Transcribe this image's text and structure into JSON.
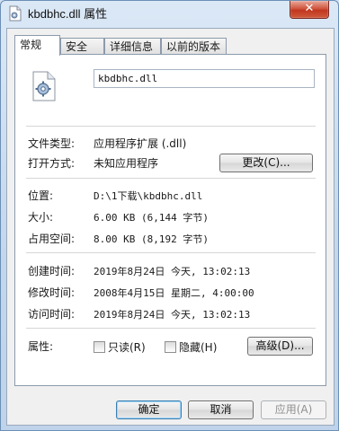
{
  "window": {
    "title": "kbdbhc.dll 属性",
    "close_glyph": "✕"
  },
  "tabs": [
    {
      "label": "常规",
      "active": true
    },
    {
      "label": "安全",
      "active": false
    },
    {
      "label": "详细信息",
      "active": false
    },
    {
      "label": "以前的版本",
      "active": false
    }
  ],
  "general": {
    "file_name": "kbdbhc.dll",
    "file_type_label": "文件类型:",
    "file_type_value": "应用程序扩展 (.dll)",
    "open_with_label": "打开方式:",
    "open_with_value": "未知应用程序",
    "change_button": "更改(C)...",
    "location_label": "位置:",
    "location_value": "D:\\1下载\\kbdbhc.dll",
    "size_label": "大小:",
    "size_value": "6.00 KB (6,144 字节)",
    "size_on_disk_label": "占用空间:",
    "size_on_disk_value": "8.00 KB (8,192 字节)",
    "created_label": "创建时间:",
    "created_value": "2019年8月24日 今天, 13:02:13",
    "modified_label": "修改时间:",
    "modified_value": "2008年4月15日 星期二, 4:00:00",
    "accessed_label": "访问时间:",
    "accessed_value": "2019年8月24日 今天, 13:02:13",
    "attributes_label": "属性:",
    "readonly_label": "只读(R)",
    "readonly_checked": false,
    "hidden_label": "隐藏(H)",
    "hidden_checked": false,
    "advanced_button": "高级(D)..."
  },
  "footer": {
    "ok": "确定",
    "cancel": "取消",
    "apply": "应用(A)",
    "apply_enabled": false
  },
  "colors": {
    "window_frame": "#c3d6ec",
    "close_button": "#c1361f",
    "default_button_border": "#3c7fb1"
  },
  "icons": {
    "title_icon": "dll-file-icon",
    "file_icon": "dll-gear-document-icon"
  }
}
